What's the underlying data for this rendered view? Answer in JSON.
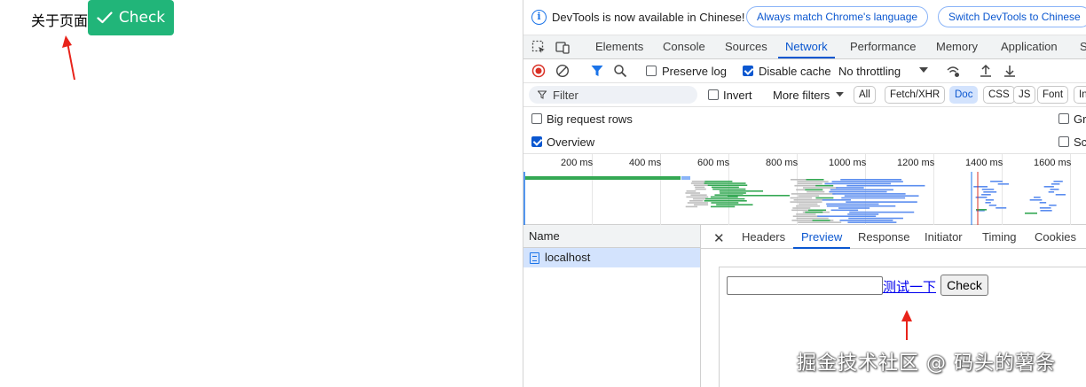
{
  "page": {
    "text": "关于页面",
    "check_button": "Check"
  },
  "devtools": {
    "info_bar": {
      "message": "DevTools is now available in Chinese!",
      "btn_match": "Always match Chrome's language",
      "btn_switch": "Switch DevTools to Chinese"
    },
    "tabs": [
      "Elements",
      "Console",
      "Sources",
      "Network",
      "Performance",
      "Memory",
      "Application",
      "S"
    ],
    "active_tab": "Network",
    "toolbar": {
      "preserve_log": "Preserve log",
      "disable_cache": "Disable cache",
      "throttling": "No throttling"
    },
    "filter": {
      "placeholder": "Filter",
      "invert": "Invert",
      "more_filters": "More filters",
      "types": [
        "All",
        "Fetch/XHR",
        "Doc",
        "CSS",
        "JS",
        "Font",
        "In"
      ],
      "active_type": "Doc"
    },
    "options": {
      "big_rows": "Big request rows",
      "overview": "Overview",
      "group": "Gro",
      "screenshots": "Scr"
    },
    "timeline_ticks": [
      "200 ms",
      "400 ms",
      "600 ms",
      "800 ms",
      "1000 ms",
      "1200 ms",
      "1400 ms",
      "1600 ms"
    ],
    "requests": {
      "header": "Name",
      "rows": [
        "localhost"
      ]
    },
    "detail_tabs": [
      "Headers",
      "Preview",
      "Response",
      "Initiator",
      "Timing",
      "Cookies"
    ],
    "active_detail_tab": "Preview",
    "preview": {
      "link_text": "测试一下",
      "button": "Check"
    }
  },
  "watermark": "掘金技术社区 @ 码头的薯条",
  "colors": {
    "accent_green": "#21b579",
    "devtools_blue": "#0b57d0",
    "annotation_red": "#e8231a"
  }
}
